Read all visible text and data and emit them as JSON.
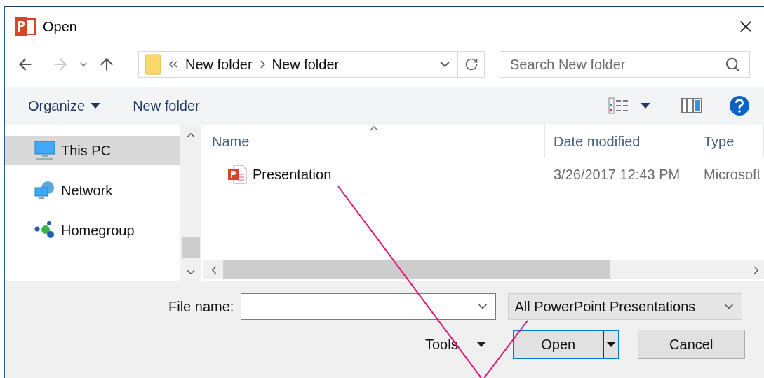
{
  "window": {
    "title": "Open"
  },
  "address_bar": {
    "path": [
      "New folder",
      "New folder"
    ]
  },
  "search": {
    "placeholder": "Search New folder"
  },
  "toolbar": {
    "organize": "Organize",
    "new_folder": "New folder"
  },
  "sidebar": {
    "items": [
      {
        "label": "This PC",
        "kind": "pc",
        "selected": true
      },
      {
        "label": "Network",
        "kind": "network",
        "selected": false
      },
      {
        "label": "Homegroup",
        "kind": "homegroup",
        "selected": false
      }
    ]
  },
  "file_list": {
    "columns": [
      {
        "label": "Name",
        "sorted": true
      },
      {
        "label": "Date modified",
        "sorted": false
      },
      {
        "label": "Type",
        "sorted": false
      }
    ],
    "rows": [
      {
        "name": "Presentation",
        "date_modified": "3/26/2017 12:43 PM",
        "type": "Microsoft"
      }
    ]
  },
  "footer": {
    "file_name_label": "File name:",
    "file_type": "All PowerPoint Presentations",
    "tools": "Tools",
    "open": "Open",
    "cancel": "Cancel"
  }
}
